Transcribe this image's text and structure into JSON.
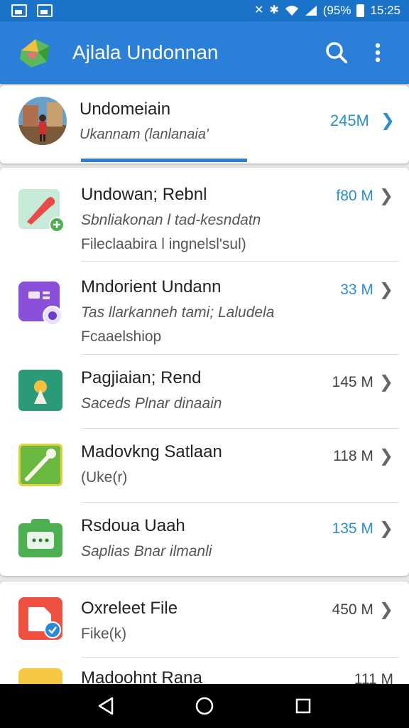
{
  "status_bar": {
    "icons_left": [
      "gallery-icon",
      "image-icon"
    ],
    "icons_right": [
      "bluetooth-off-icon",
      "bluetooth-icon",
      "wifi-icon",
      "signal-icon"
    ],
    "battery_text": "(95%",
    "time": "15:25"
  },
  "app_bar": {
    "title": "Ajlala Undonnan",
    "search_icon": "search-icon",
    "more_icon": "more-vert-icon",
    "colors": {
      "primary": "#2b7fd8",
      "status": "#1a73c8"
    }
  },
  "header": {
    "name": "Undomeiain",
    "subtitle": "Ukannam (lanlanaia'",
    "size": "245M"
  },
  "items": [
    {
      "title": "Undowan; Rebnl",
      "line1": "Sbnliakonan l tad-kesndatn",
      "line2": "Fileclaabira l ingnelsl'sul)",
      "size": "f80 M",
      "size_blue": true,
      "icon": "pen-add-icon"
    },
    {
      "title": "Mndorient Undann",
      "line1": "Tas llarkanneh tami; Laludela",
      "line2": "Fcaaelshiop",
      "size": "33 M",
      "size_blue": true,
      "icon": "game-icon"
    },
    {
      "title": "Pagjiaian; Rend",
      "line1": "Saceds Plnar dinaain",
      "line2": "",
      "size": "145 M",
      "size_blue": false,
      "icon": "lightbulb-icon"
    },
    {
      "title": "Madovkng Satlaan",
      "line1": "(Uke(r)",
      "line2": "",
      "size": "118 M",
      "size_blue": false,
      "icon": "brush-icon"
    },
    {
      "title": "Rsdoua Uaah",
      "line1": "Saplias Bnar ilmanli",
      "line2": "",
      "size": "135 M",
      "size_blue": true,
      "icon": "chat-icon"
    }
  ],
  "items2": [
    {
      "title": "Oxreleet File",
      "line1": "Fike(k)",
      "size": "450 M",
      "icon": "file-check-icon"
    },
    {
      "title": "Madoohnt Rana",
      "size": "111 M",
      "icon": "folder-icon"
    }
  ],
  "nav": {
    "back": "back-icon",
    "home": "home-icon",
    "recents": "recents-icon"
  }
}
